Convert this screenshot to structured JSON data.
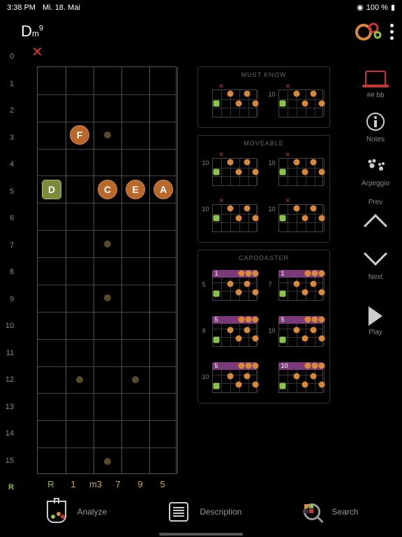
{
  "status": {
    "time": "3:38 PM",
    "date": "Mi. 18. Mai",
    "wifi": "wifi",
    "battery": "100 %"
  },
  "chord": {
    "root": "D",
    "quality": "m",
    "ext": "9"
  },
  "fretNumbers": [
    "0",
    "1",
    "2",
    "3",
    "4",
    "5",
    "6",
    "7",
    "8",
    "9",
    "10",
    "11",
    "12",
    "13",
    "14",
    "15"
  ],
  "intervalRow": {
    "r": "R",
    "vals": [
      "1",
      "m3",
      "7",
      "9",
      "5"
    ]
  },
  "notes": [
    {
      "label": "F",
      "string": 1,
      "fret": 3,
      "cls": "orange"
    },
    {
      "label": "D",
      "string": 0,
      "fret": 5,
      "cls": "green root"
    },
    {
      "label": "C",
      "string": 2,
      "fret": 5,
      "cls": "orange"
    },
    {
      "label": "E",
      "string": 3,
      "fret": 5,
      "cls": "orange"
    },
    {
      "label": "A",
      "string": 4,
      "fret": 5,
      "cls": "orange"
    }
  ],
  "sections": [
    {
      "title": "MUST KNOW",
      "minis": [
        {
          "lbl": ""
        },
        {
          "lbl": "10"
        }
      ]
    },
    {
      "title": "MOVEABLE",
      "minis": [
        {
          "lbl": "10"
        },
        {
          "lbl": "10"
        },
        {
          "lbl": "10"
        },
        {
          "lbl": "10"
        }
      ]
    },
    {
      "title": "CAPODASTER",
      "minis": [
        {
          "lbl": "1",
          "barre": true,
          "b2": "5"
        },
        {
          "lbl": "1",
          "barre": true,
          "b2": "7"
        },
        {
          "lbl": "5",
          "barre": true,
          "b2": "9"
        },
        {
          "lbl": "5",
          "barre": true,
          "b2": "10"
        },
        {
          "lbl": "5",
          "barre": true,
          "b2": "10"
        },
        {
          "lbl": "10",
          "barre": true,
          "b2": ""
        }
      ]
    }
  ],
  "sidebar": {
    "sharps": "##  bb",
    "notes": "Notes",
    "arp": "Arpeggio",
    "prev": "Prev",
    "next": "Next",
    "play": "Play"
  },
  "bottom": {
    "analyze": "Analyze",
    "desc": "Description",
    "search": "Search"
  }
}
